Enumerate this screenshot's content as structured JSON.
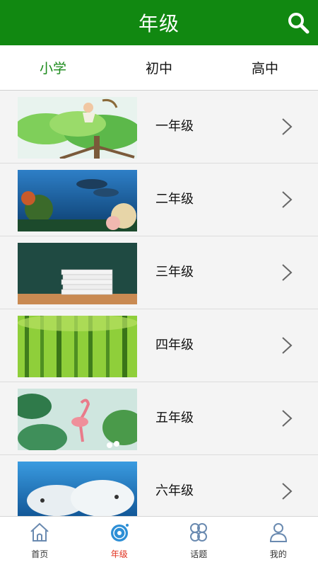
{
  "header": {
    "title": "年级"
  },
  "tabs": [
    {
      "label": "小学",
      "active": true
    },
    {
      "label": "初中",
      "active": false
    },
    {
      "label": "高中",
      "active": false
    }
  ],
  "grades": [
    {
      "label": "一年级",
      "image": "girl-in-tree"
    },
    {
      "label": "二年级",
      "image": "underwater-dolphins"
    },
    {
      "label": "三年级",
      "image": "stack-of-books"
    },
    {
      "label": "四年级",
      "image": "bamboo-forest"
    },
    {
      "label": "五年级",
      "image": "flamingo-leaves"
    },
    {
      "label": "六年级",
      "image": "beluga-whales"
    }
  ],
  "tabbar": [
    {
      "label": "首页",
      "icon": "home-icon"
    },
    {
      "label": "年级",
      "icon": "disc-icon",
      "active": true
    },
    {
      "label": "话题",
      "icon": "clover-icon"
    },
    {
      "label": "我的",
      "icon": "user-icon"
    }
  ],
  "colors": {
    "header_bg": "#118811",
    "active_tab": "#1a8a1a",
    "active_tabbar": "#e0301e"
  }
}
